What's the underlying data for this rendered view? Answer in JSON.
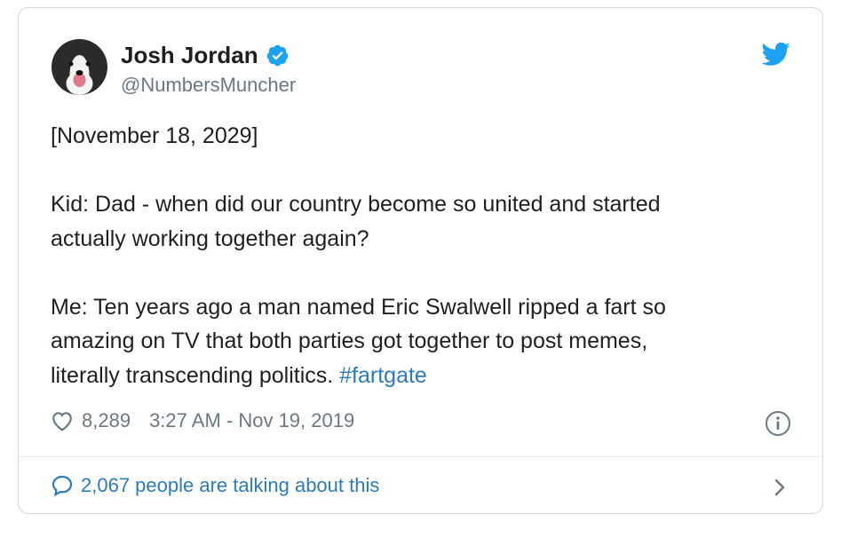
{
  "author": {
    "name": "Josh Jordan",
    "handle": "@NumbersMuncher",
    "verified": true
  },
  "tweet": {
    "text": "[November 18, 2029]\n\nKid: Dad - when did our country become so united and started\nactually working together again?\n\nMe: Ten years ago a man named Eric Swalwell ripped a fart so\namazing on TV that both parties got together to post memes,\nliterally transcending politics. ",
    "hashtag": "#fartgate"
  },
  "meta": {
    "likes": "8,289",
    "timestamp": "3:27 AM - Nov 19, 2019"
  },
  "conversation": {
    "label": "2,067 people are talking about this"
  },
  "icons": {
    "verified": "verified-badge-icon",
    "brand": "twitter-bird-icon",
    "like": "heart-icon",
    "info": "info-icon",
    "reply": "speech-bubble-icon",
    "more": "chevron-right-icon"
  },
  "colors": {
    "accent": "#1da1f2",
    "link": "#2b7bb9",
    "muted": "#697882",
    "text": "#1c2022"
  }
}
